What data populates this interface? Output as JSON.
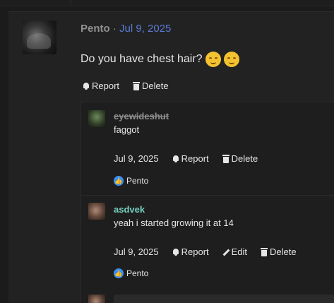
{
  "post": {
    "author": "Pento",
    "separator": "·",
    "date": "Jul 9, 2025",
    "body": "Do you have chest hair?",
    "emojis": [
      "relieved-drool-face",
      "relieved-drool-face"
    ],
    "actions": {
      "report": "Report",
      "delete": "Delete"
    }
  },
  "replies": [
    {
      "author": "eyewideshut",
      "text": "faggot",
      "date": "Jul 9, 2025",
      "actions": {
        "report": "Report",
        "delete": "Delete"
      },
      "reaction": {
        "icon": "like-icon",
        "user": "Pento"
      }
    },
    {
      "author": "asdvek",
      "text": "yeah i started growing it at 14",
      "date": "Jul 9, 2025",
      "actions": {
        "report": "Report",
        "edit": "Edit",
        "delete": "Delete"
      },
      "reaction": {
        "icon": "like-icon",
        "user": "Pento"
      }
    }
  ],
  "colors": {
    "background": "#1b1b1b",
    "link": "#5a7bd6",
    "name_accent": "#74d0c0",
    "like": "#3a8ff0"
  }
}
